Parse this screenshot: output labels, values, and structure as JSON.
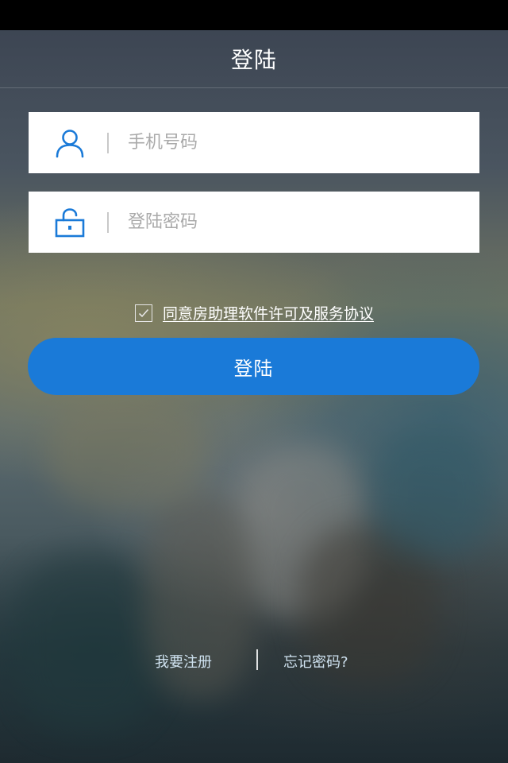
{
  "header": {
    "title": "登陆"
  },
  "form": {
    "phone_placeholder": "手机号码",
    "phone_icon": "user-icon",
    "password_placeholder": "登陆密码",
    "password_icon": "unlock-icon",
    "agree_checked": true,
    "agree_text": "同意房助理软件许可及服务协议",
    "login_label": "登陆"
  },
  "footer": {
    "register_label": "我要注册",
    "forgot_label": "忘记密码?"
  },
  "colors": {
    "accent": "#1a7ad8",
    "icon": "#1a7ad8",
    "link": "#cfe2f0"
  }
}
